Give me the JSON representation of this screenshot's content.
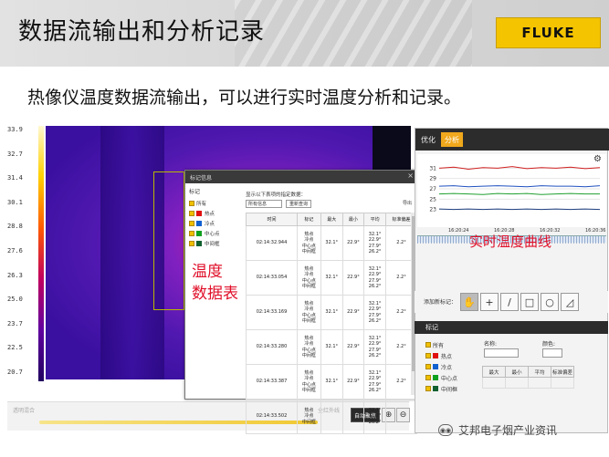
{
  "slide": {
    "title": "数据流输出和分析记录",
    "subtitle": "热像仪温度数据流输出，可以进行实时温度分析和记录。",
    "brand": "FLUKE"
  },
  "scale": {
    "ticks": [
      "33.9",
      "32.7",
      "31.4",
      "30.1",
      "28.8",
      "27.6",
      "26.3",
      "25.0",
      "23.7",
      "22.5",
      "20.7"
    ]
  },
  "bottom": {
    "left_label": "透明混合",
    "right_label": "全红外线",
    "auto_button": "自动聚焦",
    "zoom_in": "⊕",
    "zoom_out": "⊖"
  },
  "marker_dialog": {
    "title": "标记信息",
    "section": "标记",
    "legend": [
      {
        "label": "所有",
        "color": ""
      },
      {
        "label": "热点",
        "color": "#e01010"
      },
      {
        "label": "冷点",
        "color": "#1060d0"
      },
      {
        "label": "中心点",
        "color": "#10a020"
      },
      {
        "label": "中间框",
        "color": "#106030"
      }
    ],
    "question": "显示以下表项的指定数据：",
    "select": "所有信息",
    "reset": "重新查询",
    "export": "导出",
    "columns": [
      "时间",
      "标记",
      "最大",
      "最小",
      "平均",
      "标准偏差"
    ],
    "rows": [
      {
        "time": "02:14:32.944",
        "marks": "热点\n冷点\n中心点\n中间框",
        "max": "32.1°",
        "min": "22.9°",
        "avg": "32.1°\n22.9°\n27.9°\n26.2°",
        "std": "2.2°"
      },
      {
        "time": "02:14:33.054",
        "marks": "热点\n冷点\n中心点\n中间框",
        "max": "32.1°",
        "min": "22.9°",
        "avg": "32.1°\n22.9°\n27.9°\n26.2°",
        "std": "2.2°"
      },
      {
        "time": "02:14:33.169",
        "marks": "热点\n冷点\n中心点\n中间框",
        "max": "32.1°",
        "min": "22.9°",
        "avg": "32.1°\n22.9°\n27.9°\n26.2°",
        "std": "2.2°"
      },
      {
        "time": "02:14:33.280",
        "marks": "热点\n冷点\n中心点\n中间框",
        "max": "32.1°",
        "min": "22.9°",
        "avg": "32.1°\n22.9°\n27.9°\n26.2°",
        "std": "2.2°"
      },
      {
        "time": "02:14:33.387",
        "marks": "热点\n冷点\n中心点\n中间框",
        "max": "32.1°",
        "min": "22.9°",
        "avg": "32.1°\n22.9°\n27.9°\n26.2°",
        "std": "2.2°"
      },
      {
        "time": "02:14:33.502",
        "marks": "热点\n冷点\n中间框",
        "max": "",
        "min": "",
        "avg": "32.1°\n31.2°\n26.2°",
        "std": ""
      }
    ]
  },
  "notes": {
    "table": "温度\n数据表",
    "curve": "实时温度曲线"
  },
  "right_panel": {
    "tabs": [
      "优化",
      "分析"
    ],
    "active_tab": 1,
    "marker_tools_label": "添加新标记：",
    "tools": [
      "✋",
      "+",
      "/",
      "□",
      "○",
      "◿"
    ],
    "section": "标记",
    "legend": [
      {
        "label": "所有",
        "color": ""
      },
      {
        "label": "热点",
        "color": "#e01010"
      },
      {
        "label": "冷点",
        "color": "#1060d0"
      },
      {
        "label": "中心点",
        "color": "#10a020"
      },
      {
        "label": "中间框",
        "color": "#106030"
      }
    ],
    "name_label": "名称:",
    "color_label": "颜色:",
    "columns": [
      "最大",
      "最小",
      "平均",
      "标准偏差"
    ],
    "watermark": "艾邦电子烟产业资讯"
  },
  "chart_data": {
    "type": "line",
    "x": [
      "16:20:24",
      "16:20:28",
      "16:20:32",
      "16:20:36"
    ],
    "x_title": "时间",
    "y_ticks": [
      23,
      25,
      27,
      29,
      31
    ],
    "ylim": [
      21,
      33
    ],
    "series": [
      {
        "color": "#d02020",
        "values": [
          31,
          31.2,
          30.8,
          31.1,
          31,
          31.3,
          30.9,
          31.1,
          31,
          31.2,
          30.9,
          31.1
        ]
      },
      {
        "color": "#2050c0",
        "values": [
          27.5,
          27.6,
          27.4,
          27.5,
          27.6,
          27.5,
          27.4,
          27.6,
          27.5,
          27.5,
          27.4,
          27.6
        ]
      },
      {
        "color": "#20a030",
        "values": [
          26,
          26.1,
          26,
          25.9,
          26.1,
          26,
          26.1,
          25.9,
          26,
          26.1,
          26,
          26
        ]
      },
      {
        "color": "#204080",
        "values": [
          23.1,
          23,
          23.1,
          23,
          23.1,
          23,
          23.1,
          23,
          23.1,
          23,
          23.1,
          23
        ]
      }
    ]
  }
}
